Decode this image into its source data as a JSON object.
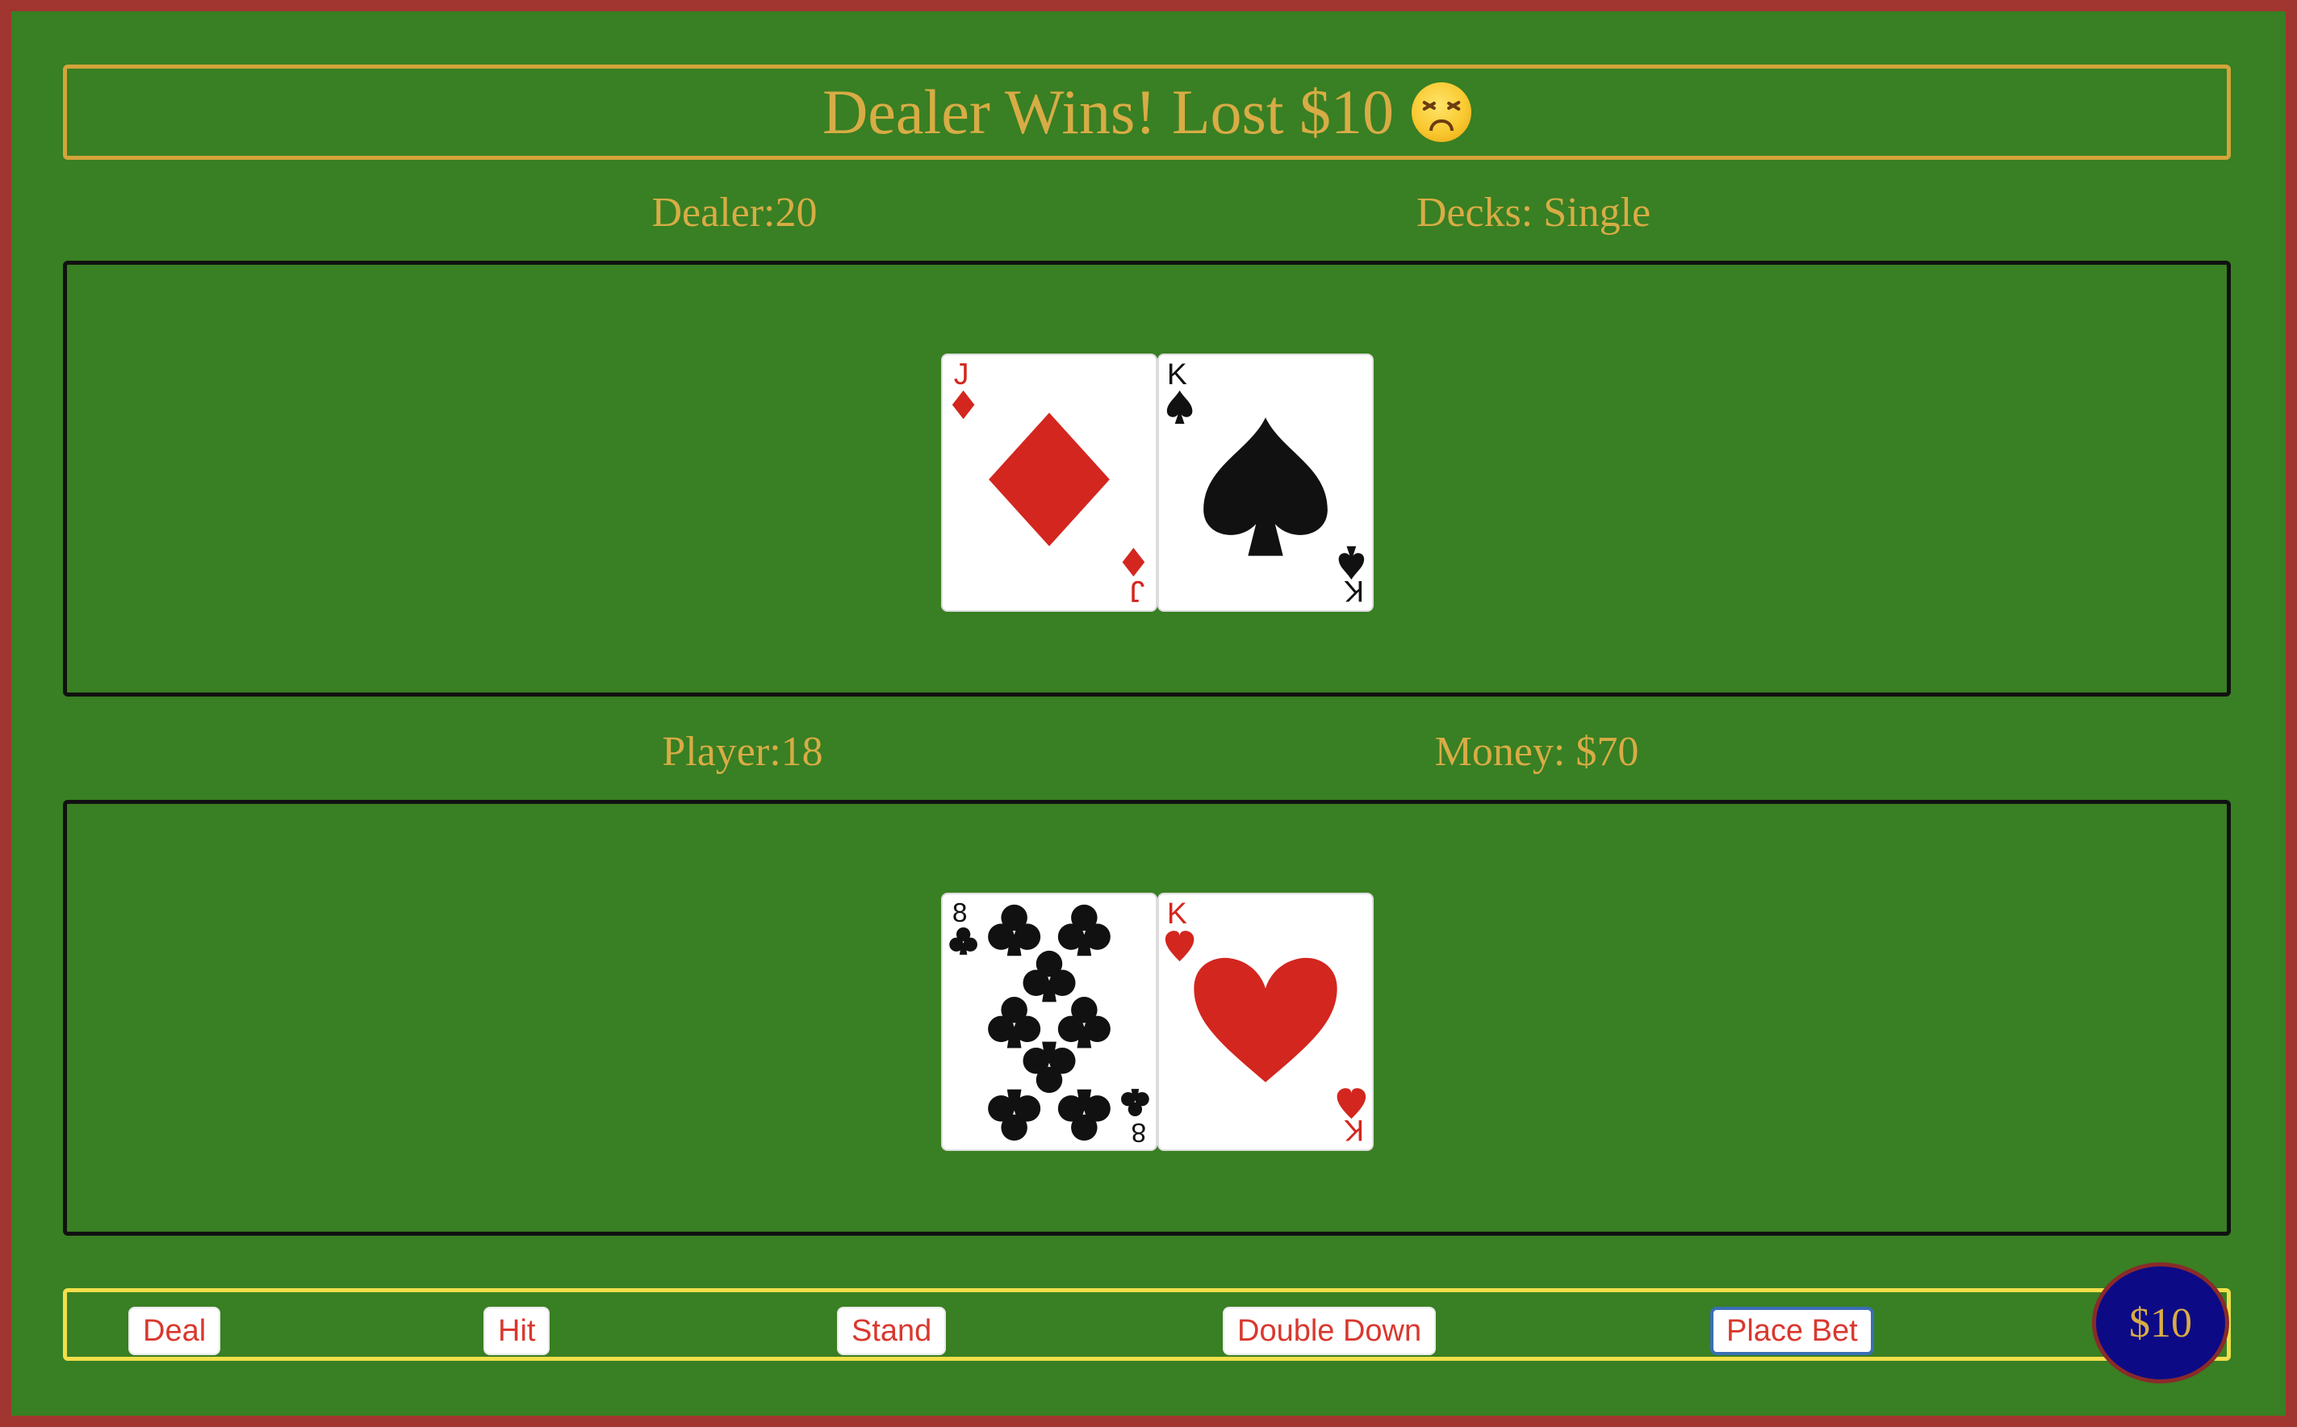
{
  "banner": {
    "text": "Dealer Wins! Lost $10",
    "emoji": "persevering-face-icon"
  },
  "dealer": {
    "label": "Dealer:20",
    "decks": "Decks: Single",
    "cards": [
      {
        "rank": "J",
        "suit": "diamonds",
        "color": "#d3261f"
      },
      {
        "rank": "K",
        "suit": "spades",
        "color": "#111111"
      }
    ]
  },
  "player": {
    "label": "Player:18",
    "money": "Money: $70",
    "cards": [
      {
        "rank": "8",
        "suit": "clubs",
        "color": "#111111"
      },
      {
        "rank": "K",
        "suit": "hearts",
        "color": "#d3261f"
      }
    ]
  },
  "controls": {
    "deal": "Deal",
    "hit": "Hit",
    "stand": "Stand",
    "double_down": "Double Down",
    "place_bet": "Place Bet"
  },
  "bet_chip": "$10",
  "colors": {
    "felt": "#397f23",
    "border": "#a13530",
    "gold": "#d8ac45",
    "button_text": "#d9382e",
    "chip": "#0d0a86"
  }
}
